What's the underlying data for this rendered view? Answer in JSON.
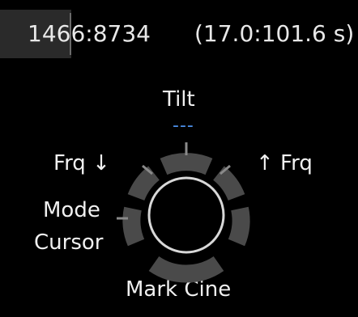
{
  "readout": {
    "frame_range": "1466:8734",
    "time_range": "(17.0:101.6 s)"
  },
  "knob": {
    "top_label": "Tilt",
    "top_value": "---",
    "left_label": "Frq ↓",
    "right_label": "↑ Frq",
    "side_labels": [
      "Mode",
      "Cursor"
    ],
    "bottom_label": "Mark Cine"
  },
  "colors": {
    "background": "#000000",
    "text": "#f0f0f0",
    "value_accent": "#4c8ee8",
    "segment": "#4a4a4a",
    "ring": "#d8d8d8"
  }
}
